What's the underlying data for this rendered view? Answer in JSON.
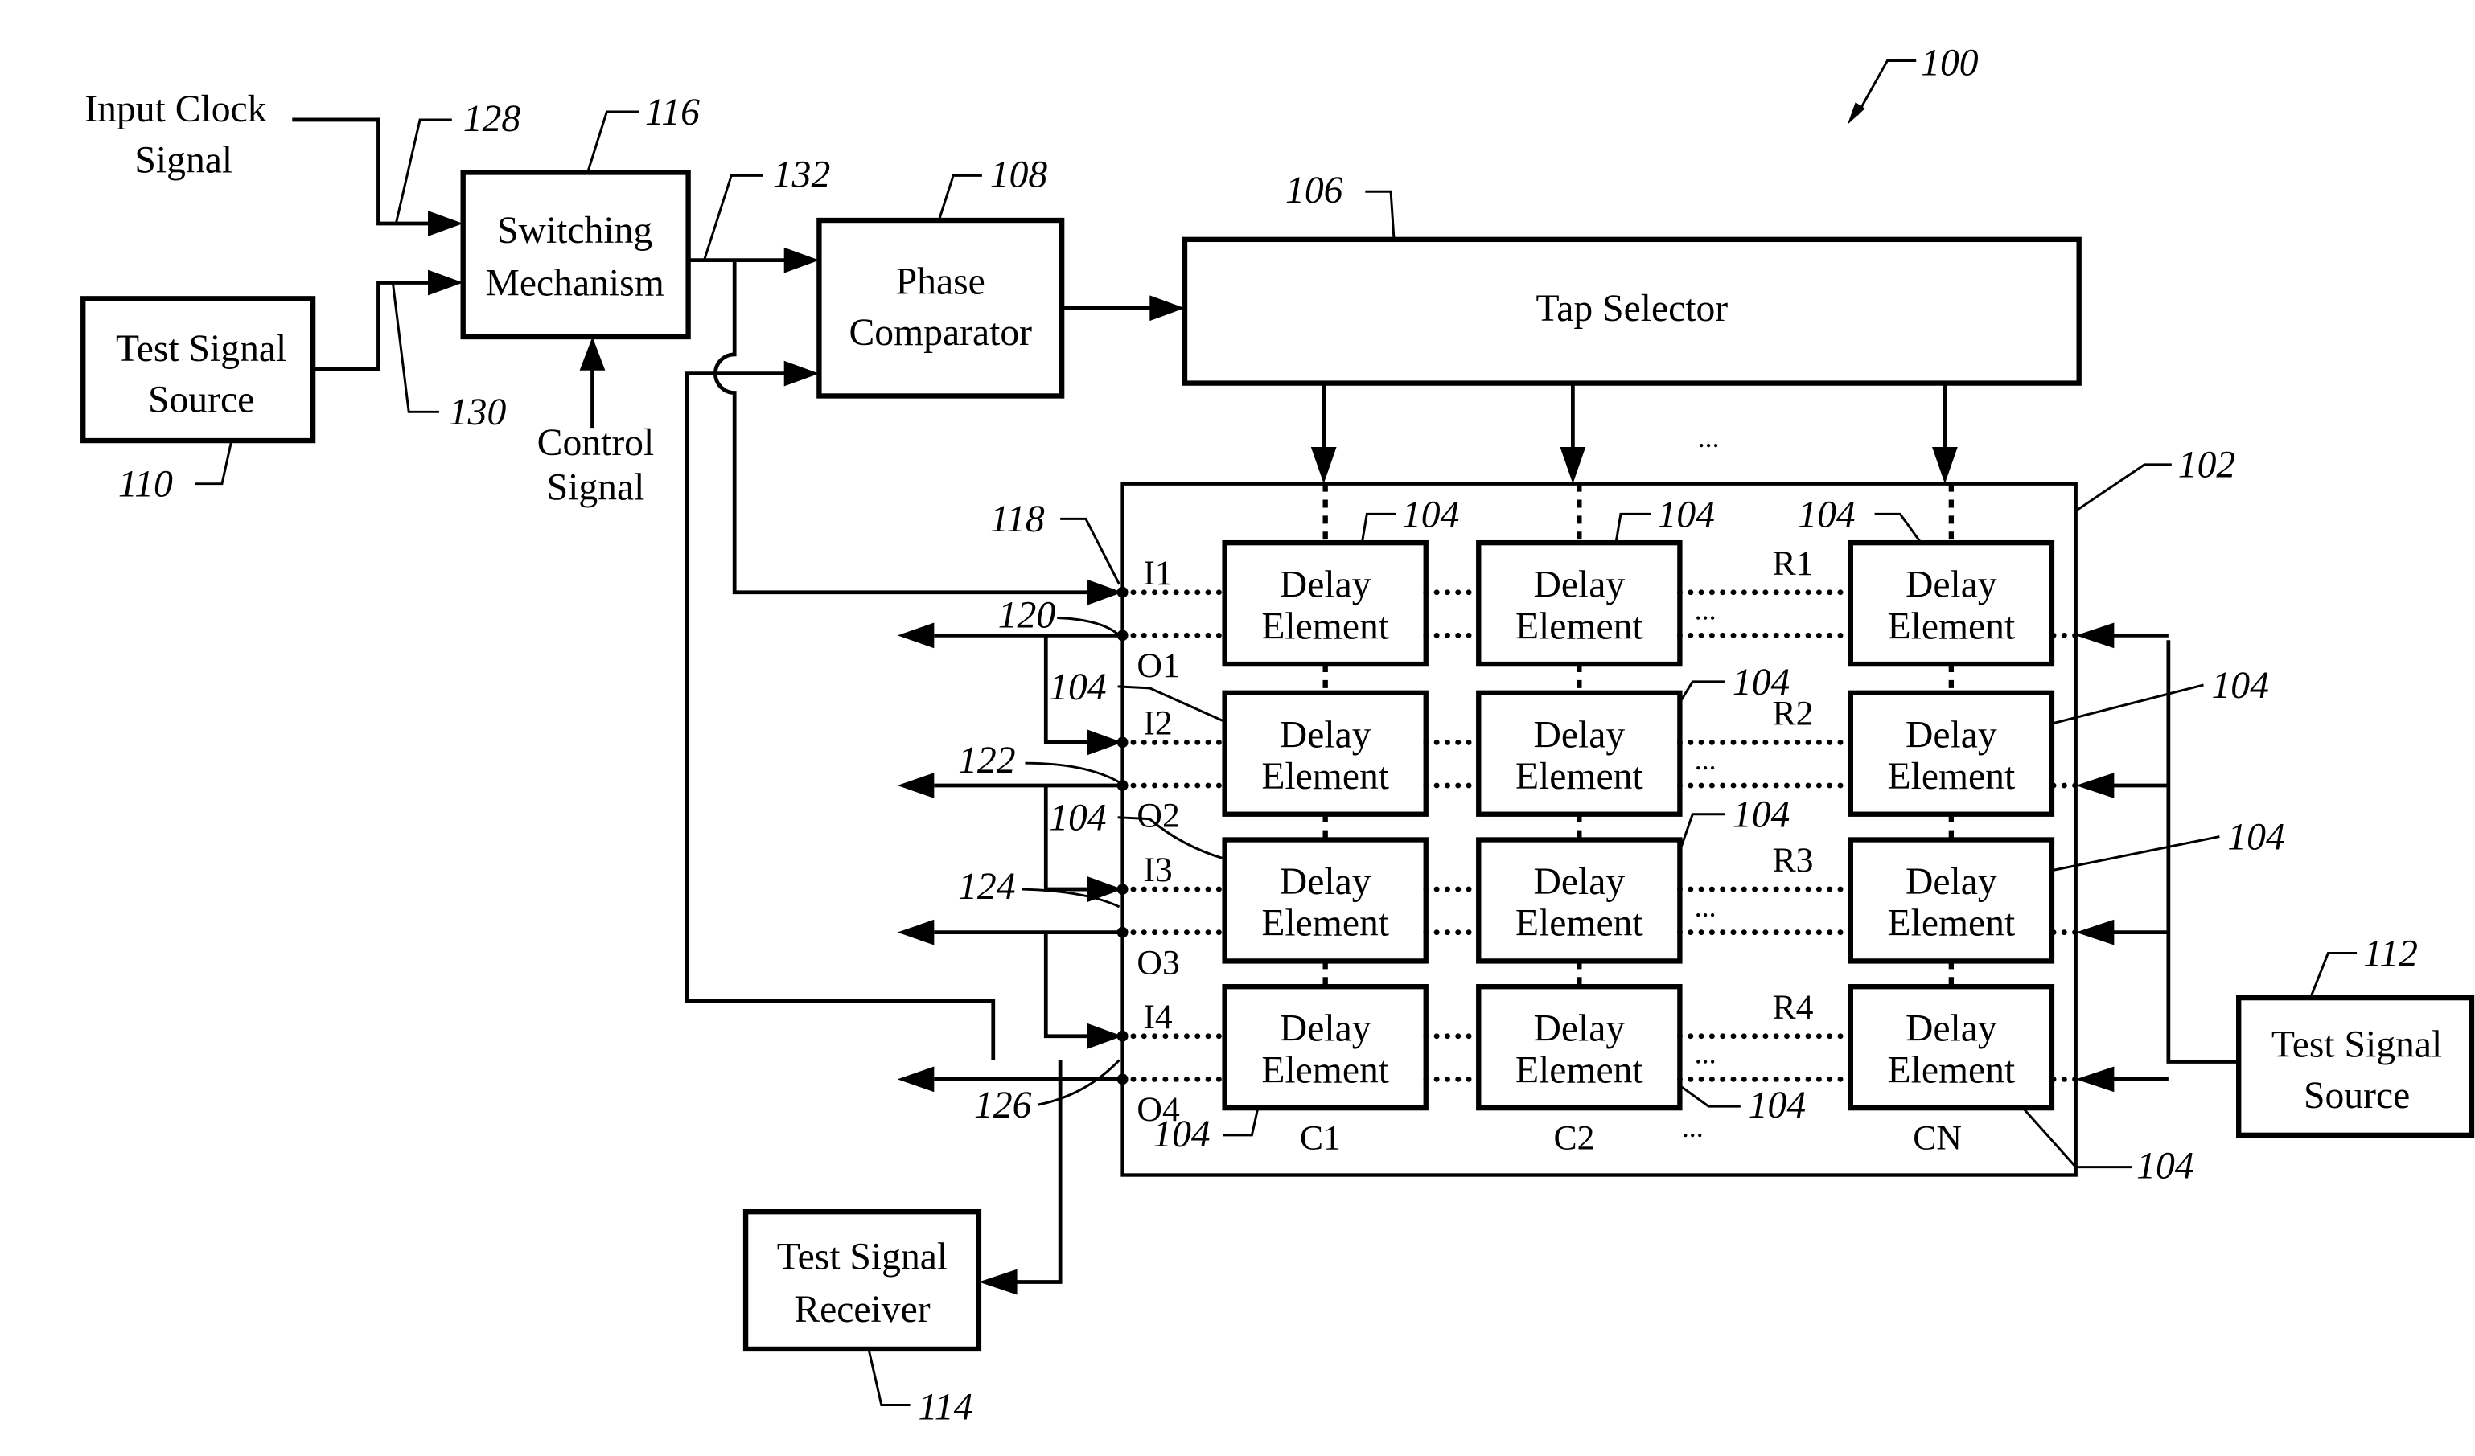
{
  "figure": {
    "reference": "100",
    "ellipsis": "..."
  },
  "blocks": {
    "input_clock": {
      "line1": "Input Clock",
      "line2": "Signal"
    },
    "test_source_left": {
      "line1": "Test Signal",
      "line2": "Source",
      "ref": "110"
    },
    "switching": {
      "line1": "Switching",
      "line2": "Mechanism",
      "ref": "116"
    },
    "control": {
      "line1": "Control",
      "line2": "Signal"
    },
    "phase": {
      "line1": "Phase",
      "line2": "Comparator",
      "ref": "108"
    },
    "tap": {
      "label": "Tap Selector",
      "ref": "106"
    },
    "array": {
      "ref": "102"
    },
    "test_source_right": {
      "line1": "Test Signal",
      "line2": "Source",
      "ref": "112"
    },
    "receiver": {
      "line1": "Test Signal",
      "line2": "Receiver",
      "ref": "114"
    }
  },
  "signals": {
    "clock_in_ref": "128",
    "test_in_ref": "130",
    "switch_out_ref": "132",
    "i1_ref": "118",
    "o1_ref": "120",
    "o2_ref": "122",
    "o3_ref": "124",
    "o4_ref": "126"
  },
  "delay_element": {
    "line1": "Delay",
    "line2": "Element",
    "ref": "104"
  },
  "rows": [
    {
      "in": "I1",
      "out": "O1",
      "label": "R1"
    },
    {
      "in": "I2",
      "out": "O2",
      "label": "R2"
    },
    {
      "in": "I3",
      "out": "O3",
      "label": "R3"
    },
    {
      "in": "I4",
      "out": "O4",
      "label": "R4"
    }
  ],
  "columns": [
    "C1",
    "C2",
    "CN"
  ]
}
